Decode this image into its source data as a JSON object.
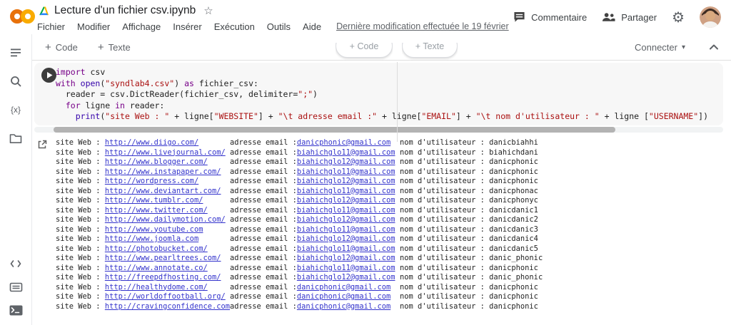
{
  "header": {
    "title": "Lecture d'un fichier csv.ipynb",
    "menu": [
      "Fichier",
      "Modifier",
      "Affichage",
      "Insérer",
      "Exécution",
      "Outils",
      "Aide"
    ],
    "last_modified": "Dernière modification effectuée le 19 février",
    "comment_label": "Commentaire",
    "share_label": "Partager",
    "star_glyph": "☆",
    "gear_glyph": "⚙"
  },
  "toolbar": {
    "add_code": "Code",
    "add_text": "Texte",
    "plus_glyph": "+",
    "connect_label": "Connecter",
    "caret_glyph": "▾"
  },
  "insert_buttons": {
    "code": "+ Code",
    "text": "+ Texte"
  },
  "sidebar": {
    "items": [
      "table-of-contents",
      "search",
      "variables",
      "files",
      "code-snippets",
      "command-palette",
      "terminal"
    ],
    "variables_glyph": "{x}"
  },
  "code_cell": {
    "lines": [
      [
        {
          "t": "import",
          "c": "kw"
        },
        {
          "t": " csv",
          "c": "pl"
        }
      ],
      [
        {
          "t": "with",
          "c": "kw"
        },
        {
          "t": " ",
          "c": "pl"
        },
        {
          "t": "open",
          "c": "bi"
        },
        {
          "t": "(",
          "c": "pl"
        },
        {
          "t": "\"syndlab4.csv\"",
          "c": "str"
        },
        {
          "t": ") ",
          "c": "pl"
        },
        {
          "t": "as",
          "c": "kw"
        },
        {
          "t": " fichier_csv:",
          "c": "pl"
        }
      ],
      [
        {
          "t": "  reader = csv.DictReader(fichier_csv, delimiter=",
          "c": "pl"
        },
        {
          "t": "\";\"",
          "c": "str"
        },
        {
          "t": ")",
          "c": "pl"
        }
      ],
      [
        {
          "t": "  ",
          "c": "pl"
        },
        {
          "t": "for",
          "c": "kw"
        },
        {
          "t": " ligne ",
          "c": "pl"
        },
        {
          "t": "in",
          "c": "kw"
        },
        {
          "t": " reader:",
          "c": "pl"
        }
      ],
      [
        {
          "t": "    ",
          "c": "pl"
        },
        {
          "t": "print",
          "c": "bi"
        },
        {
          "t": "(",
          "c": "pl"
        },
        {
          "t": "\"site Web : \"",
          "c": "str"
        },
        {
          "t": " + ligne[",
          "c": "pl"
        },
        {
          "t": "\"WEBSITE\"",
          "c": "str"
        },
        {
          "t": "] + ",
          "c": "pl"
        },
        {
          "t": "\"\\t adresse email :\"",
          "c": "str"
        },
        {
          "t": " + ligne[",
          "c": "pl"
        },
        {
          "t": "\"EMAIL\"",
          "c": "str"
        },
        {
          "t": "] + ",
          "c": "pl"
        },
        {
          "t": "\"\\t nom d'utilisateur : \"",
          "c": "str"
        },
        {
          "t": " + ligne [",
          "c": "pl"
        },
        {
          "t": "\"USERNAME\"",
          "c": "str"
        },
        {
          "t": "])",
          "c": "pl"
        }
      ]
    ]
  },
  "output": {
    "site_label": "site Web : ",
    "email_label": "adresse email :",
    "user_label": "nom d'utilisateur : ",
    "rows": [
      {
        "website": "http://www.diigo.com/",
        "email": "danicphonic@gmail.com",
        "username": "danicbiahhi"
      },
      {
        "website": "http://www.livejournal.com/",
        "email": "biahichglo11@gmail.com",
        "username": "biahichdani"
      },
      {
        "website": "http://www.blogger.com/",
        "email": "biahichglo12@gmail.com",
        "username": "danicphonic"
      },
      {
        "website": "http://www.instapaper.com/",
        "email": "biahichglo11@gmail.com",
        "username": "danicphonic"
      },
      {
        "website": "http://wordpress.com/",
        "email": "biahichglo12@gmail.com",
        "username": "danicphonic"
      },
      {
        "website": "http://www.deviantart.com/",
        "email": "biahichglo11@gmail.com",
        "username": "danicphonac"
      },
      {
        "website": "http://www.tumblr.com/",
        "email": "biahichglo12@gmail.com",
        "username": "danicphonyc"
      },
      {
        "website": "http://www.twitter.com/",
        "email": "biahichglo11@gmail.com",
        "username": "danicdanic1"
      },
      {
        "website": "http://www.dailymotion.com/",
        "email": "biahichglo12@gmail.com",
        "username": "danicdanic2"
      },
      {
        "website": "http://www.youtube.com",
        "email": "biahichglo11@gmail.com",
        "username": "danicdanic3"
      },
      {
        "website": "http://www.joomla.com",
        "email": "biahichglo12@gmail.com",
        "username": "danicdanic4"
      },
      {
        "website": "http://photobucket.com/",
        "email": "biahichglo11@gmail.com",
        "username": "danicdanic5"
      },
      {
        "website": "http://www.pearltrees.com/",
        "email": "biahichglo12@gmail.com",
        "username": "danic_phonic"
      },
      {
        "website": "http://www.annotate.co/",
        "email": "biahichglo11@gmail.com",
        "username": "danicphonic"
      },
      {
        "website": "http://freepdfhosting.com/",
        "email": "biahichglo12@gmail.com",
        "username": "danic_phonic"
      },
      {
        "website": "http://healthydome.com/",
        "email": "danicphonic@gmail.com",
        "username": "danicphonic"
      },
      {
        "website": "http://worldoffootball.org/",
        "email": "danicphonic@gmail.com",
        "username": "danicphonic"
      },
      {
        "website": "http://cravingconfidence.com",
        "email": "danicphonic@gmail.com",
        "username": "danicphonic"
      }
    ]
  },
  "colors": {
    "logo_orange": "#E8710A",
    "logo_yellow": "#F9AB00",
    "link": "#3333cc",
    "keyword": "#770088",
    "string": "#aa1111",
    "builtin": "#3300aa",
    "run_button": "#3c3c3c"
  }
}
